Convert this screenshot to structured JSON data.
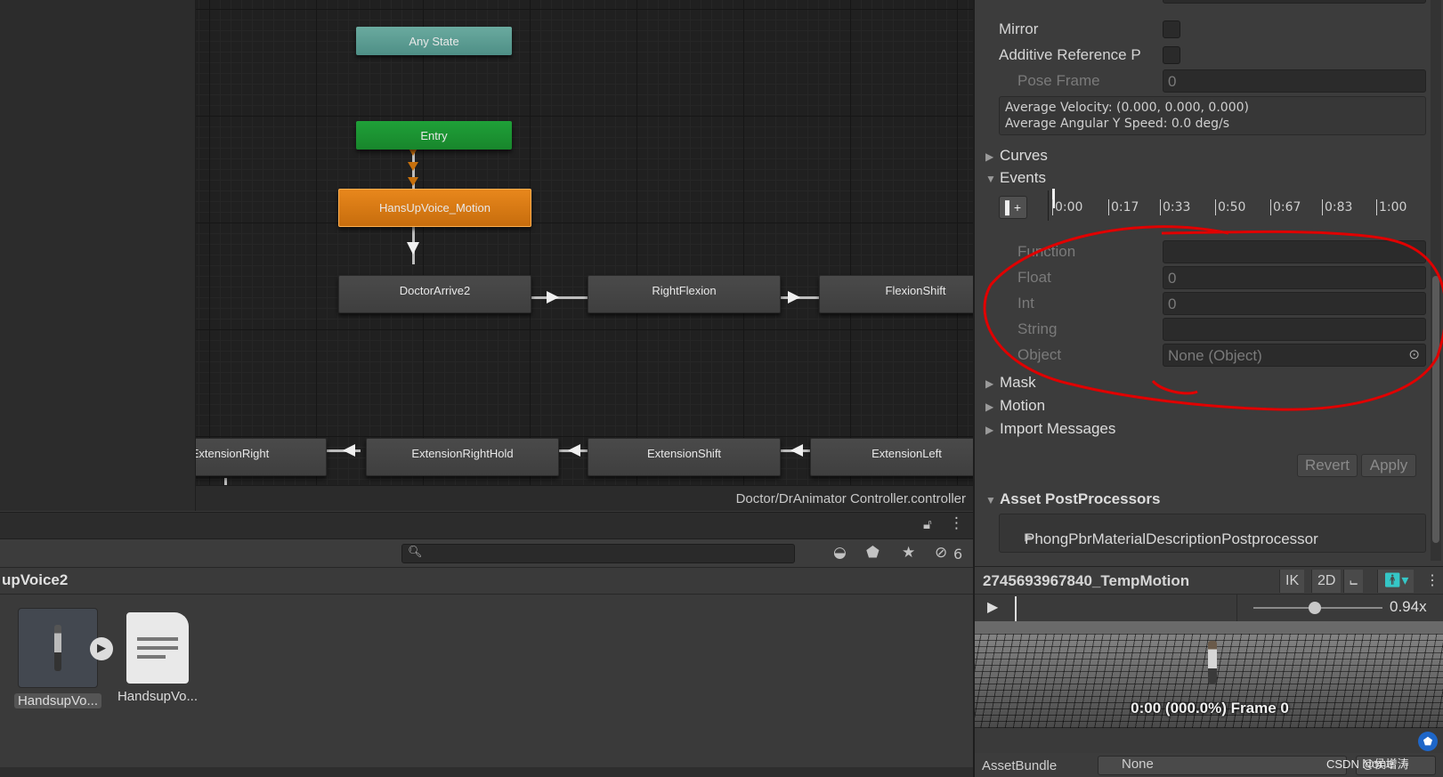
{
  "graph": {
    "nodes": {
      "any_state": "Any State",
      "entry": "Entry",
      "default_state": "HansUpVoice_Motion",
      "doctor_arrive": "DoctorArrive2",
      "right_flexion": "RightFlexion",
      "flexion_shift": "FlexionShift",
      "extension_right": "ExtensionRight",
      "extension_right_hold": "ExtensionRightHold",
      "extension_shift": "ExtensionShift",
      "extension_left": "ExtensionLeft"
    },
    "footer_path": "Doctor/DrAnimator Controller.controller"
  },
  "project": {
    "breadcrumb": "upVoice2",
    "hidden_count": "6",
    "assets": [
      {
        "label": "HandsupVo...",
        "icon": "animation-clip-thumbnail"
      },
      {
        "label": "HandsupVo...",
        "icon": "text-document-icon"
      }
    ]
  },
  "inspector": {
    "mirror_label": "Mirror",
    "additive_label": "Additive Reference P",
    "pose_frame_label": "Pose Frame",
    "pose_frame_value": "0",
    "avg_velocity": "Average Velocity: (0.000, 0.000, 0.000)",
    "avg_angular": "Average Angular Y Speed: 0.0 deg/s",
    "curves_label": "Curves",
    "events_label": "Events",
    "timeline_ticks": [
      "0:00",
      "0:17",
      "0:33",
      "0:50",
      "0:67",
      "0:83",
      "1:00"
    ],
    "event_fields": {
      "function_label": "Function",
      "function_value": "",
      "float_label": "Float",
      "float_value": "0",
      "int_label": "Int",
      "int_value": "0",
      "string_label": "String",
      "string_value": "",
      "object_label": "Object",
      "object_value": "None (Object)"
    },
    "mask_label": "Mask",
    "motion_label": "Motion",
    "import_messages_label": "Import Messages",
    "revert_label": "Revert",
    "apply_label": "Apply",
    "asset_postprocessors_label": "Asset PostProcessors",
    "postprocessor_item": "PhongPbrMaterialDescriptionPostprocessor"
  },
  "preview": {
    "title": "2745693967840_TempMotion",
    "ik_label": "IK",
    "mode_2d_label": "2D",
    "speed": "0.94x",
    "frame_text": "0:00 (000.0%) Frame 0",
    "playback_position": 0.0
  },
  "assetbundle": {
    "label": "AssetBundle",
    "value": "None",
    "variant": "None"
  },
  "watermark": "CSDN @侯增涛",
  "colors": {
    "any_state": "#5a9b91",
    "entry": "#1c9432",
    "default_state": "#d97a14",
    "annotation": "#e00000"
  }
}
